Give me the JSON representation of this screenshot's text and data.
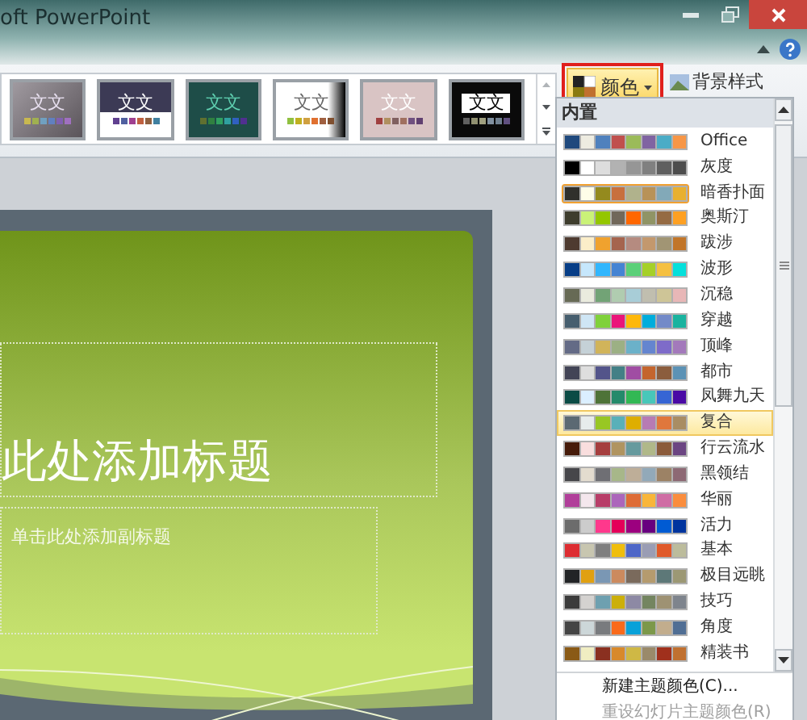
{
  "window": {
    "title": "oft PowerPoint"
  },
  "gallery": [
    {
      "text": "文文",
      "swatches": [
        {
          "color": "#c8b850"
        },
        {
          "color": "#a0b050"
        },
        {
          "color": "#70a0c0"
        },
        {
          "color": "#6080c0"
        },
        {
          "color": "#8060b0"
        },
        {
          "color": "#a070c0"
        }
      ]
    },
    {
      "text": "文文",
      "swatches": [
        {
          "color": "#604090"
        },
        {
          "color": "#5060a0"
        },
        {
          "color": "#a04090"
        },
        {
          "color": "#c06040"
        },
        {
          "color": "#906040"
        },
        {
          "color": "#4080a0"
        }
      ]
    },
    {
      "text": "文文",
      "swatches": [
        {
          "color": "#607030"
        },
        {
          "color": "#308040"
        },
        {
          "color": "#30a060"
        },
        {
          "color": "#30a0a0"
        },
        {
          "color": "#3060c0"
        },
        {
          "color": "#503090"
        }
      ]
    },
    {
      "text": "文文",
      "swatches": [
        {
          "color": "#90c040"
        },
        {
          "color": "#c0b020"
        },
        {
          "color": "#d0a040"
        },
        {
          "color": "#e07030"
        },
        {
          "color": "#a06040"
        },
        {
          "color": "#805030"
        }
      ]
    },
    {
      "text": "文文",
      "swatches": [
        {
          "color": "#a04040"
        },
        {
          "color": "#b09060"
        },
        {
          "color": "#806060"
        },
        {
          "color": "#a07060"
        },
        {
          "color": "#705080"
        },
        {
          "color": "#604070"
        }
      ]
    },
    {
      "text": "文文",
      "swatches": [
        {
          "color": "#606060"
        },
        {
          "color": "#909070"
        },
        {
          "color": "#a0a080"
        },
        {
          "color": "#8090a0"
        },
        {
          "color": "#708090"
        },
        {
          "color": "#605080"
        }
      ]
    }
  ],
  "colors_button": {
    "label": "颜色"
  },
  "background_styles": {
    "label": "背景样式"
  },
  "dropdown": {
    "header": "内置",
    "themes": [
      {
        "name": "Office",
        "current": false,
        "hovered": false,
        "swatches": [
          {
            "color": "#1f497d"
          },
          {
            "color": "#eeece1"
          },
          {
            "color": "#4f81bd"
          },
          {
            "color": "#c0504d"
          },
          {
            "color": "#9bbb59"
          },
          {
            "color": "#8064a2"
          },
          {
            "color": "#4bacc6"
          },
          {
            "color": "#f79646"
          }
        ]
      },
      {
        "name": "灰度",
        "current": false,
        "hovered": false,
        "swatches": [
          {
            "color": "#000000"
          },
          {
            "color": "#ffffff"
          },
          {
            "color": "#dddddd"
          },
          {
            "color": "#b2b2b2"
          },
          {
            "color": "#969696"
          },
          {
            "color": "#808080"
          },
          {
            "color": "#5f5f5f"
          },
          {
            "color": "#4d4d4d"
          }
        ]
      },
      {
        "name": "暗香扑面",
        "current": true,
        "hovered": false,
        "swatches": [
          {
            "color": "#30302c"
          },
          {
            "color": "#fefde8"
          },
          {
            "color": "#948a1e"
          },
          {
            "color": "#c8703e"
          },
          {
            "color": "#b0b28c"
          },
          {
            "color": "#b89258"
          },
          {
            "color": "#82a9b8"
          },
          {
            "color": "#e8b030"
          }
        ]
      },
      {
        "name": "奥斯汀",
        "current": false,
        "hovered": false,
        "swatches": [
          {
            "color": "#3e3d2d"
          },
          {
            "color": "#caf278"
          },
          {
            "color": "#94c600"
          },
          {
            "color": "#71685a"
          },
          {
            "color": "#ff6700"
          },
          {
            "color": "#909465"
          },
          {
            "color": "#956b43"
          },
          {
            "color": "#fea022"
          }
        ]
      },
      {
        "name": "跋涉",
        "current": false,
        "hovered": false,
        "swatches": [
          {
            "color": "#4e3b30"
          },
          {
            "color": "#fbeec9"
          },
          {
            "color": "#f0a22e"
          },
          {
            "color": "#a5644e"
          },
          {
            "color": "#b58b80"
          },
          {
            "color": "#c3986d"
          },
          {
            "color": "#a19574"
          },
          {
            "color": "#c17529"
          }
        ]
      },
      {
        "name": "波形",
        "current": false,
        "hovered": false,
        "swatches": [
          {
            "color": "#073e87"
          },
          {
            "color": "#c6e7fc"
          },
          {
            "color": "#31b6fd"
          },
          {
            "color": "#4584d3"
          },
          {
            "color": "#5bd078"
          },
          {
            "color": "#a5d028"
          },
          {
            "color": "#f5c040"
          },
          {
            "color": "#05e0db"
          }
        ]
      },
      {
        "name": "沉稳",
        "current": false,
        "hovered": false,
        "swatches": [
          {
            "color": "#676a55"
          },
          {
            "color": "#eaebde"
          },
          {
            "color": "#72a376"
          },
          {
            "color": "#b0ccb0"
          },
          {
            "color": "#a8cdd7"
          },
          {
            "color": "#c0beaf"
          },
          {
            "color": "#cec597"
          },
          {
            "color": "#e8b7b7"
          }
        ]
      },
      {
        "name": "穿越",
        "current": false,
        "hovered": false,
        "swatches": [
          {
            "color": "#465e6e"
          },
          {
            "color": "#cfe6f5"
          },
          {
            "color": "#7fd13b"
          },
          {
            "color": "#ea157a"
          },
          {
            "color": "#feb80a"
          },
          {
            "color": "#00addc"
          },
          {
            "color": "#738ac8"
          },
          {
            "color": "#1ab39f"
          }
        ]
      },
      {
        "name": "顶峰",
        "current": false,
        "hovered": false,
        "swatches": [
          {
            "color": "#646b86"
          },
          {
            "color": "#c5d1d7"
          },
          {
            "color": "#d1b45a"
          },
          {
            "color": "#9cb084"
          },
          {
            "color": "#6bb1c9"
          },
          {
            "color": "#6585cf"
          },
          {
            "color": "#7e6bc9"
          },
          {
            "color": "#a379bb"
          }
        ]
      },
      {
        "name": "都市",
        "current": false,
        "hovered": false,
        "swatches": [
          {
            "color": "#424456"
          },
          {
            "color": "#dedede"
          },
          {
            "color": "#53548a"
          },
          {
            "color": "#438086"
          },
          {
            "color": "#a04da3"
          },
          {
            "color": "#c4652d"
          },
          {
            "color": "#8b5d3d"
          },
          {
            "color": "#5c92b5"
          }
        ]
      },
      {
        "name": "凤舞九天",
        "current": false,
        "hovered": false,
        "swatches": [
          {
            "color": "#0b4b45"
          },
          {
            "color": "#dbefff"
          },
          {
            "color": "#4e7338"
          },
          {
            "color": "#248a6b"
          },
          {
            "color": "#32b854"
          },
          {
            "color": "#48c7b9"
          },
          {
            "color": "#3665d4"
          },
          {
            "color": "#4a0aa5"
          }
        ]
      },
      {
        "name": "复合",
        "current": false,
        "hovered": true,
        "swatches": [
          {
            "color": "#5b6973"
          },
          {
            "color": "#e7ecec"
          },
          {
            "color": "#98c723"
          },
          {
            "color": "#59b0b9"
          },
          {
            "color": "#deae00"
          },
          {
            "color": "#b77bb4"
          },
          {
            "color": "#e0773c"
          },
          {
            "color": "#a98d63"
          }
        ]
      },
      {
        "name": "行云流水",
        "current": false,
        "hovered": false,
        "swatches": [
          {
            "color": "#461b0a"
          },
          {
            "color": "#f9dede"
          },
          {
            "color": "#a53e3e"
          },
          {
            "color": "#b09460"
          },
          {
            "color": "#669a9e"
          },
          {
            "color": "#b0b889"
          },
          {
            "color": "#8b5b3b"
          },
          {
            "color": "#6b4582"
          }
        ]
      },
      {
        "name": "黑领结",
        "current": false,
        "hovered": false,
        "swatches": [
          {
            "color": "#46464a"
          },
          {
            "color": "#e3dccf"
          },
          {
            "color": "#6f6f74"
          },
          {
            "color": "#a7b789"
          },
          {
            "color": "#beae98"
          },
          {
            "color": "#92a9b9"
          },
          {
            "color": "#9c8265"
          },
          {
            "color": "#8d6974"
          }
        ]
      },
      {
        "name": "华丽",
        "current": false,
        "hovered": false,
        "swatches": [
          {
            "color": "#b13f9a"
          },
          {
            "color": "#f4e7ed"
          },
          {
            "color": "#b83d68"
          },
          {
            "color": "#ac66bb"
          },
          {
            "color": "#de6c36"
          },
          {
            "color": "#f9b639"
          },
          {
            "color": "#cf6da4"
          },
          {
            "color": "#fa8d3d"
          }
        ]
      },
      {
        "name": "活力",
        "current": false,
        "hovered": false,
        "swatches": [
          {
            "color": "#6c6c6c"
          },
          {
            "color": "#cccccc"
          },
          {
            "color": "#ff388c"
          },
          {
            "color": "#e40059"
          },
          {
            "color": "#9c007f"
          },
          {
            "color": "#68007f"
          },
          {
            "color": "#005bd3"
          },
          {
            "color": "#00349e"
          }
        ]
      },
      {
        "name": "基本",
        "current": false,
        "hovered": false,
        "swatches": [
          {
            "color": "#dd2d32"
          },
          {
            "color": "#c8c6b0"
          },
          {
            "color": "#7f7f7f"
          },
          {
            "color": "#f0be0c"
          },
          {
            "color": "#4e67c8"
          },
          {
            "color": "#9a9db4"
          },
          {
            "color": "#e05a2a"
          },
          {
            "color": "#bcbc9c"
          }
        ]
      },
      {
        "name": "极目远眺",
        "current": false,
        "hovered": false,
        "swatches": [
          {
            "color": "#222426"
          },
          {
            "color": "#e0a012"
          },
          {
            "color": "#7a97b4"
          },
          {
            "color": "#cc8a5e"
          },
          {
            "color": "#7a6a5c"
          },
          {
            "color": "#b59b6e"
          },
          {
            "color": "#5d7878"
          },
          {
            "color": "#9c9874"
          }
        ]
      },
      {
        "name": "技巧",
        "current": false,
        "hovered": false,
        "swatches": [
          {
            "color": "#3b3b3b"
          },
          {
            "color": "#d4d2d0"
          },
          {
            "color": "#6ea0b0"
          },
          {
            "color": "#ccaf0a"
          },
          {
            "color": "#8d89a4"
          },
          {
            "color": "#748560"
          },
          {
            "color": "#9e9273"
          },
          {
            "color": "#7e848d"
          }
        ]
      },
      {
        "name": "角度",
        "current": false,
        "hovered": false,
        "swatches": [
          {
            "color": "#444444"
          },
          {
            "color": "#cdd7d9"
          },
          {
            "color": "#797b7e"
          },
          {
            "color": "#f96a1b"
          },
          {
            "color": "#08a1d9"
          },
          {
            "color": "#7c984a"
          },
          {
            "color": "#c2ad8d"
          },
          {
            "color": "#506e94"
          }
        ]
      },
      {
        "name": "精装书",
        "current": false,
        "hovered": false,
        "swatches": [
          {
            "color": "#8a5a16"
          },
          {
            "color": "#f0edc2"
          },
          {
            "color": "#8a3020"
          },
          {
            "color": "#d8892b"
          },
          {
            "color": "#cfb845"
          },
          {
            "color": "#9a8a6a"
          },
          {
            "color": "#a0301c"
          },
          {
            "color": "#c07030"
          }
        ]
      }
    ],
    "actions": [
      {
        "label": "新建主题颜色(C)...",
        "disabled": false
      },
      {
        "label": "重设幻灯片主题颜色(R)",
        "disabled": true
      }
    ]
  },
  "slide": {
    "title": "此处添加标题",
    "subtitle": "单击此处添加副标题"
  }
}
